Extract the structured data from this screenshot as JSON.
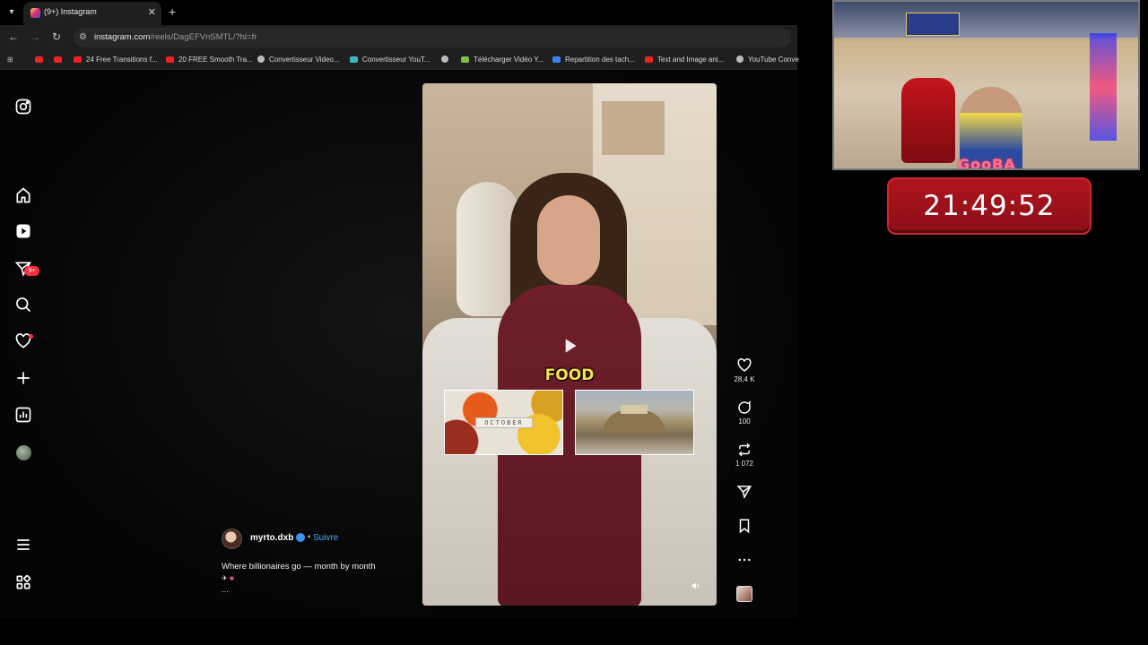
{
  "browser": {
    "tab_title": "(9+) Instagram",
    "new_tab": "+",
    "url_host": "instagram.com",
    "url_rest": "/reels/DagEFVnSMTL/?hl=fr",
    "bookmarks": [
      "24 Free Transitions f...",
      "20 FREE Smooth Tra...",
      "Convertisseur Video...",
      "Convertisseur YouT...",
      "Télécharger Vidéo Y...",
      "Repartition des tach...",
      "Text and Image ani...",
      "YouTube Conve"
    ]
  },
  "sidebar": {
    "notifications_badge": "9+",
    "icons": [
      "instagram-logo",
      "home",
      "reels",
      "messages",
      "search",
      "notifications",
      "create",
      "dashboard",
      "profile",
      "menu",
      "more"
    ]
  },
  "reel": {
    "overlay_word": "FOOD",
    "thumb_label": "OCTOBER",
    "author": {
      "username": "myrto.dxb",
      "separator": "•",
      "follow_label": "Suivre"
    },
    "description": "Where billionaires go — month by month",
    "description_more": "...",
    "likes": "28,4 K",
    "comments": "100",
    "reposts": "1 072"
  },
  "stream": {
    "logo_text": "GooBA",
    "timer": "21:49:52"
  },
  "colors": {
    "accent_blue": "#4ea3f8",
    "badge_red": "#ff3040",
    "timer_red": "#b0141e",
    "overlay_yellow": "#f7e24b"
  }
}
